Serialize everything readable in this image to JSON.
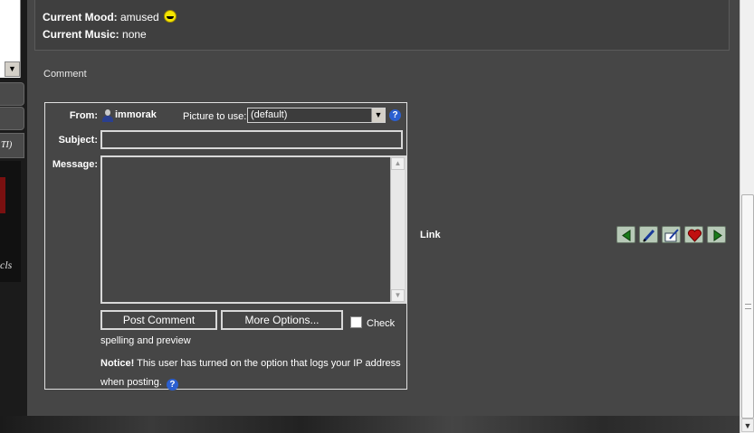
{
  "profile": {
    "mood_label": "Current Mood:",
    "mood_value": "amused",
    "music_label": "Current Music:",
    "music_value": "none"
  },
  "sidebar": {
    "tab_text": "TI)",
    "banner_text": "cls"
  },
  "comment": {
    "section_title": "Comment",
    "from_label": "From:",
    "username": "immorak",
    "picture_label": "Picture to use:",
    "picture_selected": "(default)",
    "subject_label": "Subject:",
    "subject_value": "",
    "message_label": "Message:",
    "message_value": "",
    "post_button": "Post Comment",
    "options_button": "More Options...",
    "check_label": "Check",
    "spelling_text": "spelling and preview",
    "notice_label": "Notice!",
    "notice_text": " This user has turned on the option that logs your IP address when posting.",
    "help_symbol": "?"
  },
  "entry_tools": {
    "link_label": "Link",
    "icons": [
      "prev-entry-icon",
      "edit-entry-icon",
      "tags-icon",
      "memories-icon",
      "next-entry-icon"
    ]
  },
  "colors": {
    "panel_bg": "#464646",
    "help_blue": "#2b5fd0"
  }
}
